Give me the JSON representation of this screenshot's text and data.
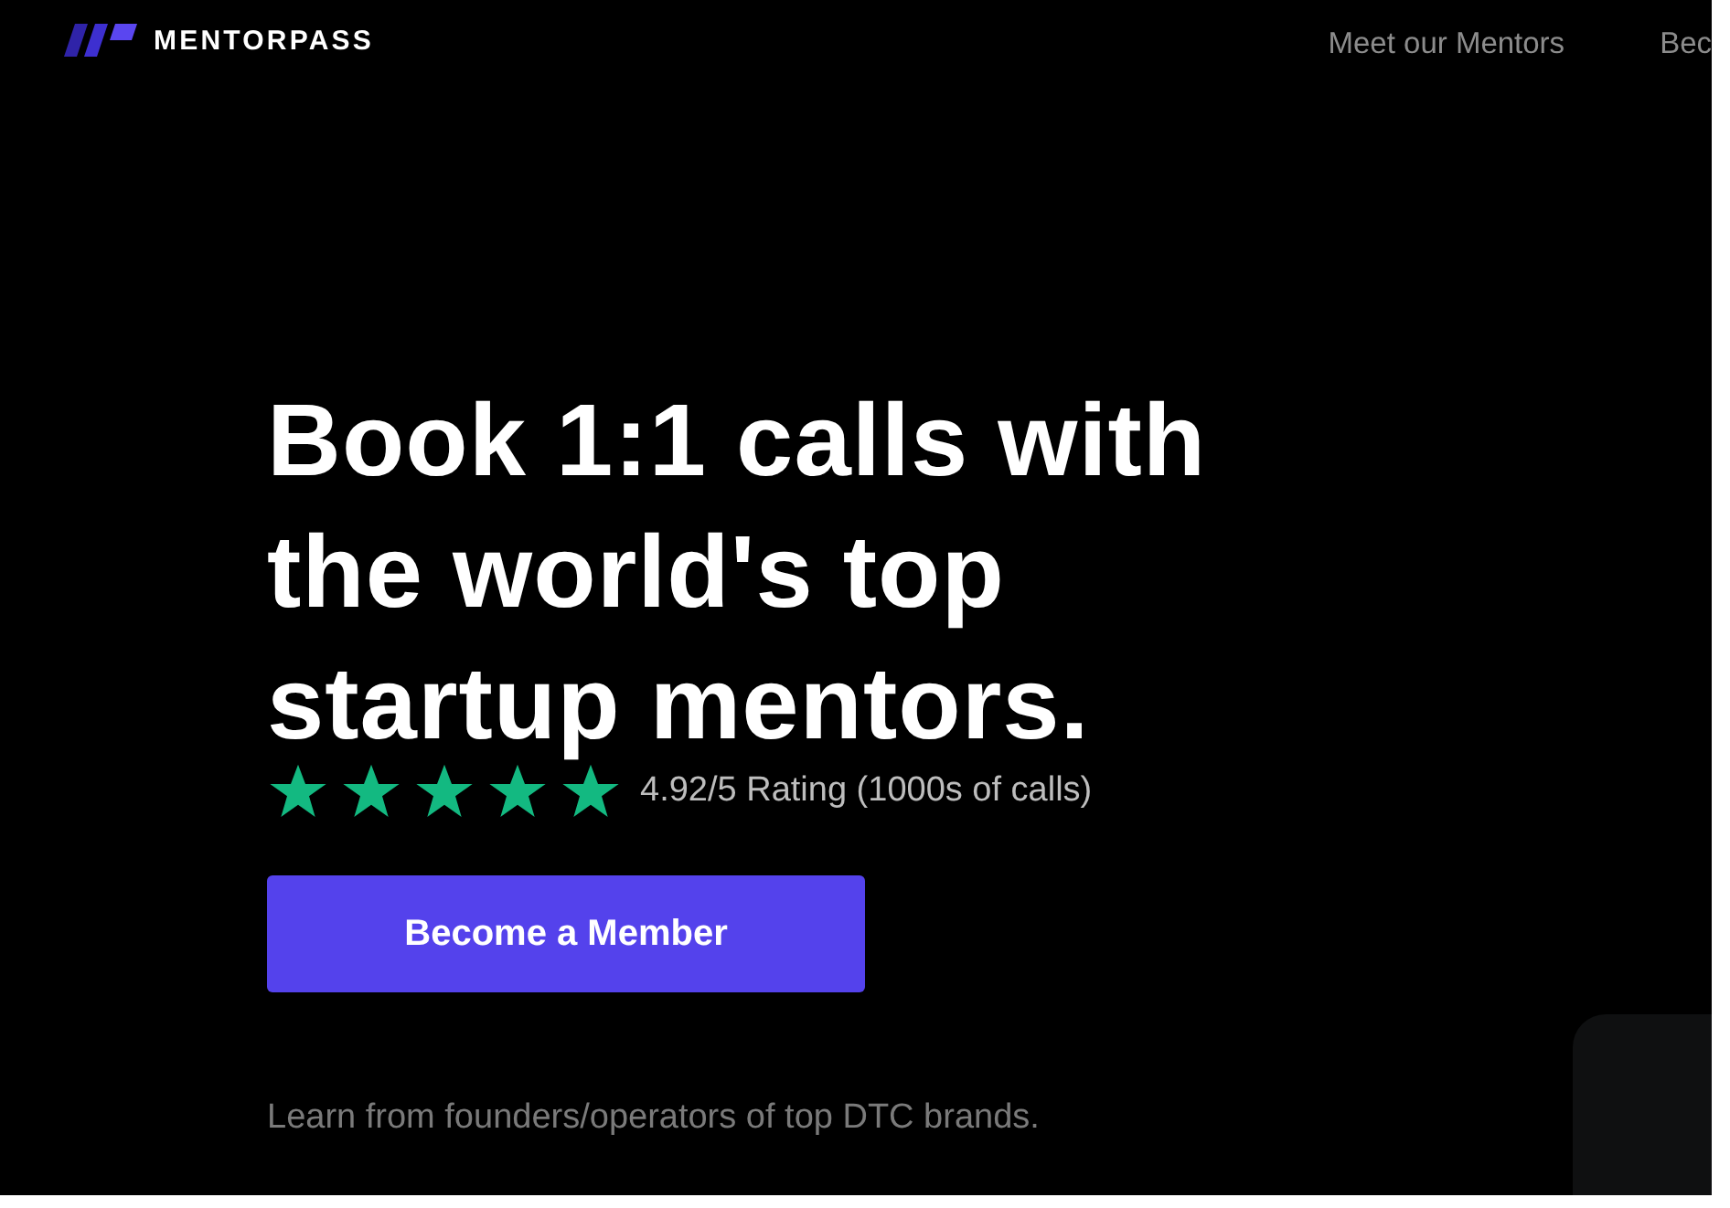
{
  "brand": {
    "name": "MENTORPASS"
  },
  "nav": [
    "Meet our Mentors",
    "Bec"
  ],
  "hero": {
    "headline": [
      "Book 1:1 calls with",
      "the world's top",
      "startup mentors."
    ],
    "rating": {
      "stars": 5,
      "text": "4.92/5 Rating (1000s of calls)"
    },
    "cta": "Become a Member",
    "subtext": "Learn from founders/operators of top DTC brands."
  }
}
